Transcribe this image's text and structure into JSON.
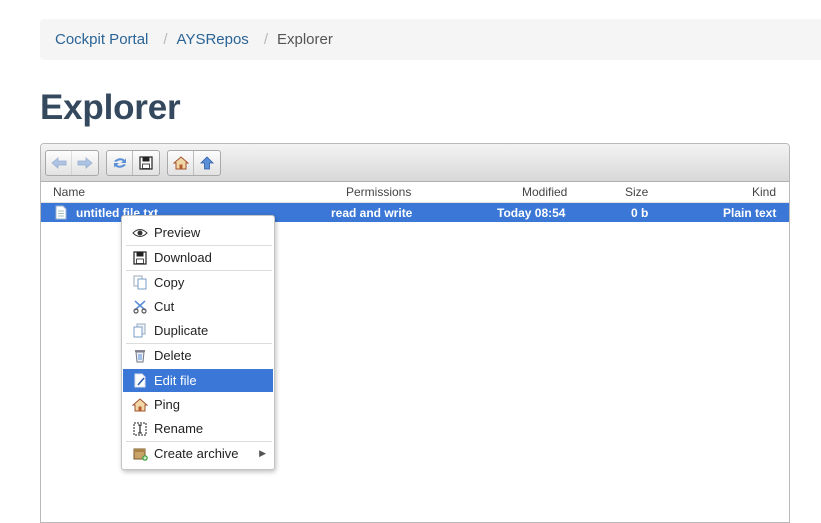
{
  "breadcrumb": {
    "items": [
      "Cockpit Portal",
      "AYSRepos"
    ],
    "separator": "/",
    "current": "Explorer"
  },
  "page": {
    "title": "Explorer"
  },
  "toolbar": {
    "buttons": [
      "back-arrow-icon",
      "forward-arrow-icon",
      "reload-icon",
      "save-icon",
      "home-icon",
      "up-arrow-icon"
    ]
  },
  "grid": {
    "columns": [
      "Name",
      "Permissions",
      "Modified",
      "Size",
      "Kind"
    ],
    "rows": [
      {
        "name": "untitled file.txt",
        "permissions": "read and write",
        "modified": "Today 08:54",
        "size": "0 b",
        "kind": "Plain text",
        "selected": true
      }
    ]
  },
  "context_menu": {
    "items": [
      {
        "label": "Preview",
        "icon": "eye-icon"
      },
      {
        "label": "Download",
        "icon": "floppy-icon"
      },
      {
        "label": "Copy",
        "icon": "copy-icon"
      },
      {
        "label": "Cut",
        "icon": "scissors-icon"
      },
      {
        "label": "Duplicate",
        "icon": "duplicate-icon"
      },
      {
        "label": "Delete",
        "icon": "trash-icon"
      },
      {
        "label": "Edit file",
        "icon": "edit-file-icon",
        "active": true
      },
      {
        "label": "Ping",
        "icon": "home-icon"
      },
      {
        "label": "Rename",
        "icon": "rename-icon"
      },
      {
        "label": "Create archive",
        "icon": "archive-icon",
        "has_submenu": true
      }
    ]
  },
  "colors": {
    "selection": "#3a77d6",
    "title": "#34495e",
    "link": "#2a6496"
  }
}
